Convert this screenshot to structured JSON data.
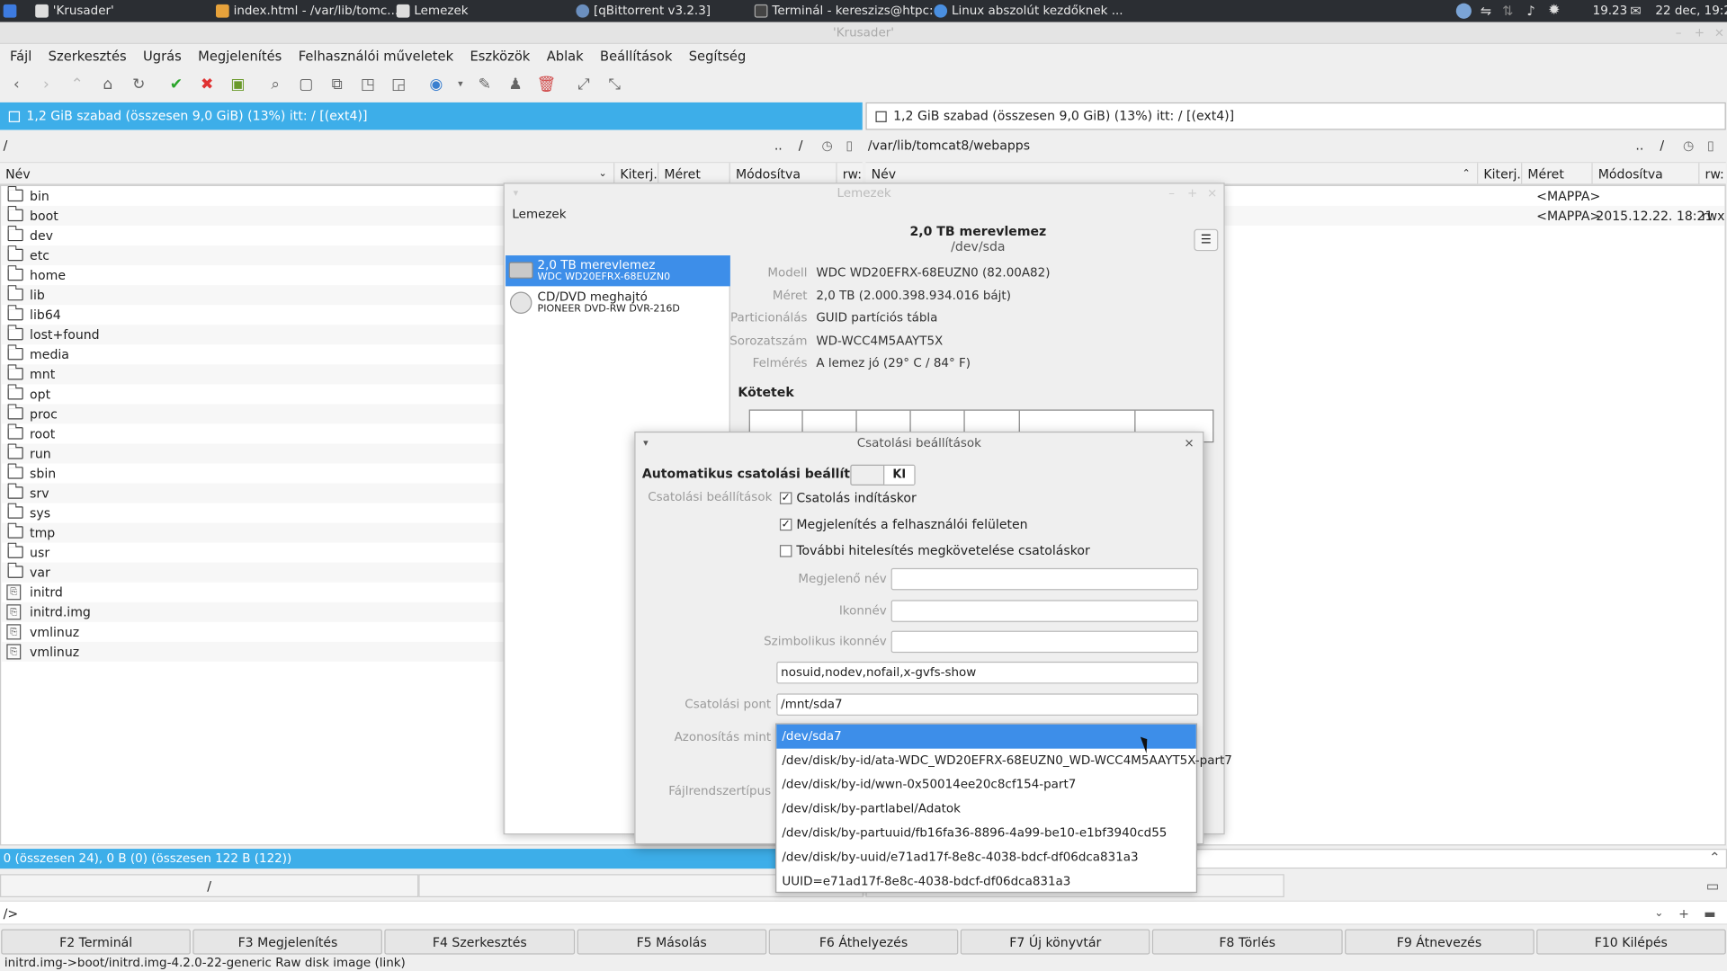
{
  "taskbar": {
    "tasks": [
      "'Krusader'",
      "index.html - /var/lib/tomc...",
      "Lemezek",
      "[qBittorrent v3.2.3]",
      "Terminál - kereszizs@htpc: ~",
      "Linux abszolút kezdőknek ..."
    ],
    "time_short": "19.23",
    "datetime": "22 dec, 19:23"
  },
  "window": {
    "title": "'Krusader'"
  },
  "menu": [
    "Fájl",
    "Szerkesztés",
    "Ugrás",
    "Megjelenítés",
    "Felhasználói műveletek",
    "Eszközök",
    "Ablak",
    "Beállítások",
    "Segítség"
  ],
  "left_panel": {
    "disk_info": "1,2 GiB szabad (összesen 9,0 GiB) (13%) itt: / [(ext4)]",
    "path": "/",
    "nav": "..",
    "nav_slash": "/",
    "columns": {
      "name": "Név",
      "ext": "Kiterj.",
      "size": "Méret",
      "modified": "Módosítva",
      "rw": "rw:"
    },
    "folders": [
      "bin",
      "boot",
      "dev",
      "etc",
      "home",
      "lib",
      "lib64",
      "lost+found",
      "media",
      "mnt",
      "opt",
      "proc",
      "root",
      "run",
      "sbin",
      "srv",
      "sys",
      "tmp",
      "usr",
      "var"
    ],
    "files": [
      "initrd",
      "initrd.img",
      "vmlinuz",
      "vmlinuz"
    ],
    "status": "0 (összesen 24), 0 B (0) (összesen 122 B (122))",
    "path_button": "/"
  },
  "right_panel": {
    "disk_info": "1,2 GiB szabad (összesen 9,0 GiB) (13%) itt: / [(ext4)]",
    "path": "/var/lib/tomcat8/webapps",
    "nav": "..",
    "nav_slash": "/",
    "columns": {
      "name": "Név",
      "ext": "Kiterj.",
      "size": "Méret",
      "modified": "Módosítva",
      "rw": "rw:"
    },
    "rows": [
      {
        "size": "<MAPPA>",
        "modified": "",
        "rw": ""
      },
      {
        "size": "<MAPPA>",
        "modified": "2015.12.22. 18:21",
        "rw": "rwx"
      }
    ]
  },
  "cmdline": {
    "prompt": "/>"
  },
  "fkeys": [
    "F2 Terminál",
    "F3 Megjelenítés",
    "F4 Szerkesztés",
    "F5 Másolás",
    "F6 Áthelyezés",
    "F7 Új könyvtár",
    "F8 Törlés",
    "F9 Átnevezés",
    "F10 Kilépés"
  ],
  "bottom_status": "initrd.img->boot/initrd.img-4.2.0-22-generic  Raw disk image (link)",
  "disks": {
    "title": "Lemezek",
    "header_label": "Lemezek",
    "device_title": "2,0 TB merevlemez",
    "device_path": "/dev/sda",
    "drives": [
      {
        "line1": "2,0 TB merevlemez",
        "line2": "WDC WD20EFRX-68EUZN0"
      },
      {
        "line1": "CD/DVD meghajtó",
        "line2": "PIONEER DVD-RW  DVR-216D"
      }
    ],
    "props": [
      {
        "label": "Modell",
        "value": "WDC WD20EFRX-68EUZN0 (82.00A82)"
      },
      {
        "label": "Méret",
        "value": "2,0 TB (2.000.398.934.016 bájt)"
      },
      {
        "label": "Particionálás",
        "value": "GUID partíciós tábla"
      },
      {
        "label": "Sorozatszám",
        "value": "WD-WCC4M5AAYT5X"
      },
      {
        "label": "Felmérés",
        "value": "A lemez jó (29° C / 84° F)"
      }
    ],
    "volumes_label": "Kötetek"
  },
  "mount_dialog": {
    "title": "Csatolási beállítások",
    "auto_label": "Automatikus csatolási beállítások",
    "toggle_state": "KI",
    "mount_options_label": "Csatolási beállítások",
    "checkboxes": [
      {
        "label": "Csatolás indításkor",
        "checked": "✓"
      },
      {
        "label": "Megjelenítés a felhasználói felületen",
        "checked": "✓"
      },
      {
        "label": "További hitelesítés megkövetelése csatoláskor",
        "checked": ""
      }
    ],
    "display_name_label": "Megjelenő név",
    "display_name_value": "",
    "icon_name_label": "Ikonnév",
    "icon_name_value": "",
    "symbolic_icon_label": "Szimbolikus ikonnév",
    "symbolic_icon_value": "",
    "options_value": "nosuid,nodev,nofail,x-gvfs-show",
    "mount_point_label": "Csatolási pont",
    "mount_point_value": "/mnt/sda7",
    "identify_label": "Azonosítás mint",
    "fs_type_label": "Fájlrendszertípus"
  },
  "identify_options": [
    "/dev/sda7",
    "/dev/disk/by-id/ata-WDC_WD20EFRX-68EUZN0_WD-WCC4M5AAYT5X-part7",
    "/dev/disk/by-id/wwn-0x50014ee20c8cf154-part7",
    "/dev/disk/by-partlabel/Adatok",
    "/dev/disk/by-partuuid/fb16fa36-8896-4a99-be10-e1bf3940cd55",
    "/dev/disk/by-uuid/e71ad17f-8e8c-4038-bdcf-df06dca831a3",
    "UUID=e71ad17f-8e8c-4038-bdcf-df06dca831a3"
  ],
  "colors": {
    "accent": "#3daee9",
    "selection": "#3d8ee9",
    "taskbar": "#2b2e33"
  }
}
